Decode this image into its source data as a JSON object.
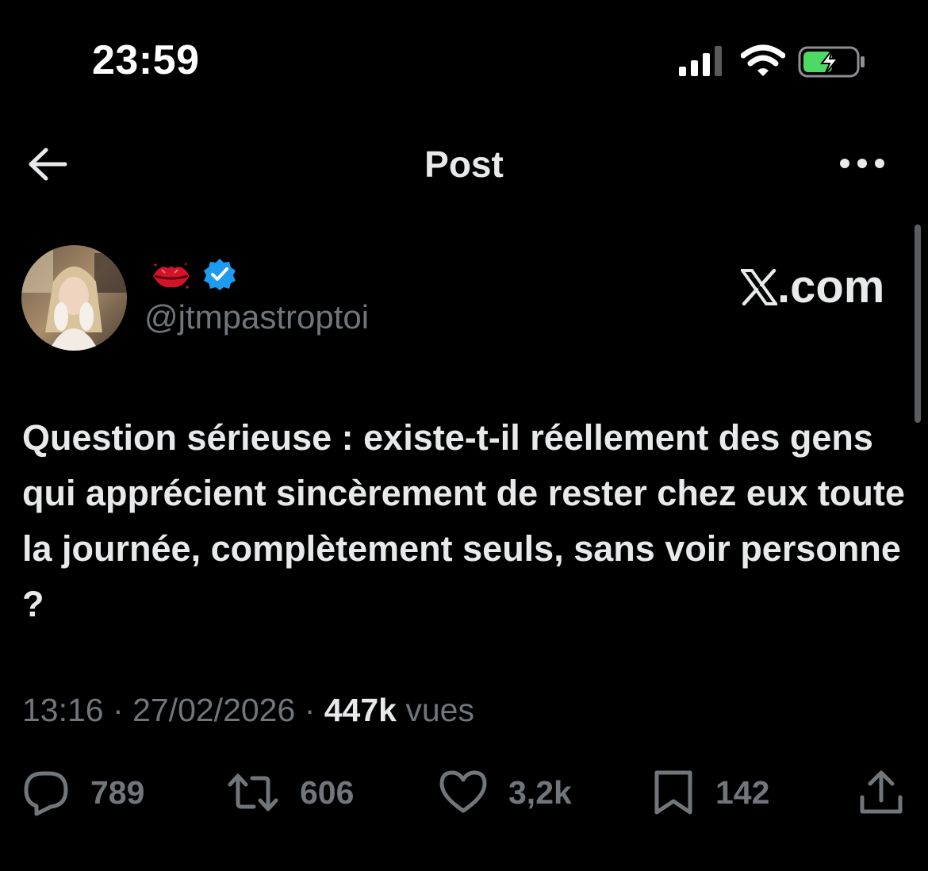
{
  "status_bar": {
    "time": "23:59",
    "icons": [
      "cellular-signal-icon",
      "wifi-icon",
      "battery-charging-icon"
    ],
    "battery_color": "#4cd964"
  },
  "nav": {
    "title": "Post",
    "back_icon": "back-arrow-icon",
    "more_icon": "more-options-icon"
  },
  "author": {
    "display_name_emoji": "💋",
    "verified_color": "#1d9bf0",
    "handle": "@jtmpastroptoi"
  },
  "watermark": {
    "logo_icon": "x-logo-icon",
    "text": ".com"
  },
  "post": {
    "text": "Question sérieuse : existe-t-il réellement des gens qui apprécient sincèrement de rester chez eux toute la journée, complètement seuls, sans voir personne ?"
  },
  "meta": {
    "time": "13:16",
    "separator": "·",
    "date": "27/02/2026",
    "views_count": "447k",
    "views_label": "vues"
  },
  "actions": {
    "reply": {
      "icon": "reply-icon",
      "count": "789"
    },
    "repost": {
      "icon": "repost-icon",
      "count": "606"
    },
    "like": {
      "icon": "heart-icon",
      "count": "3,2k"
    },
    "bookmark": {
      "icon": "bookmark-icon",
      "count": "142"
    },
    "share": {
      "icon": "share-icon"
    }
  },
  "colors": {
    "background": "#000000",
    "primary_text": "#e7e9ea",
    "secondary_text": "#71767b"
  }
}
